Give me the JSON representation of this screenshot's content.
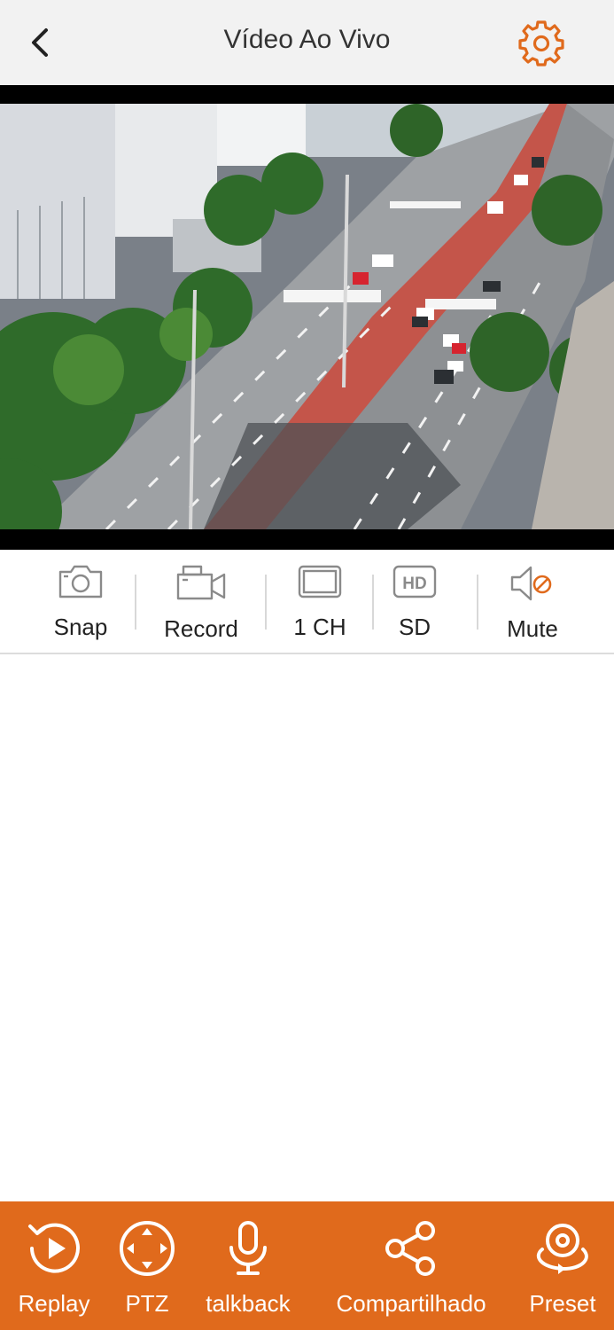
{
  "header": {
    "title": "Vídeo Ao Vivo",
    "back_icon": "chevron-left-icon",
    "settings_icon": "gear-icon",
    "accent_color": "#e06a1c"
  },
  "toolbar": {
    "items": [
      {
        "label": "Snap",
        "icon": "camera-icon"
      },
      {
        "label": "Record",
        "icon": "video-camera-icon"
      },
      {
        "label": "1 CH",
        "icon": "screen-layout-icon"
      },
      {
        "label": "SD",
        "icon": "hd-icon"
      },
      {
        "label": "Mute",
        "icon": "speaker-muted-icon"
      }
    ]
  },
  "bottom_bar": {
    "background": "#e06a1c",
    "items": [
      {
        "label": "Replay",
        "icon": "replay-icon"
      },
      {
        "label": "PTZ",
        "icon": "ptz-direction-icon"
      },
      {
        "label": "talkback",
        "icon": "microphone-icon"
      },
      {
        "label": "Compartilhado",
        "icon": "share-icon"
      },
      {
        "label": "Preset",
        "icon": "preset-rotate-icon"
      }
    ]
  }
}
